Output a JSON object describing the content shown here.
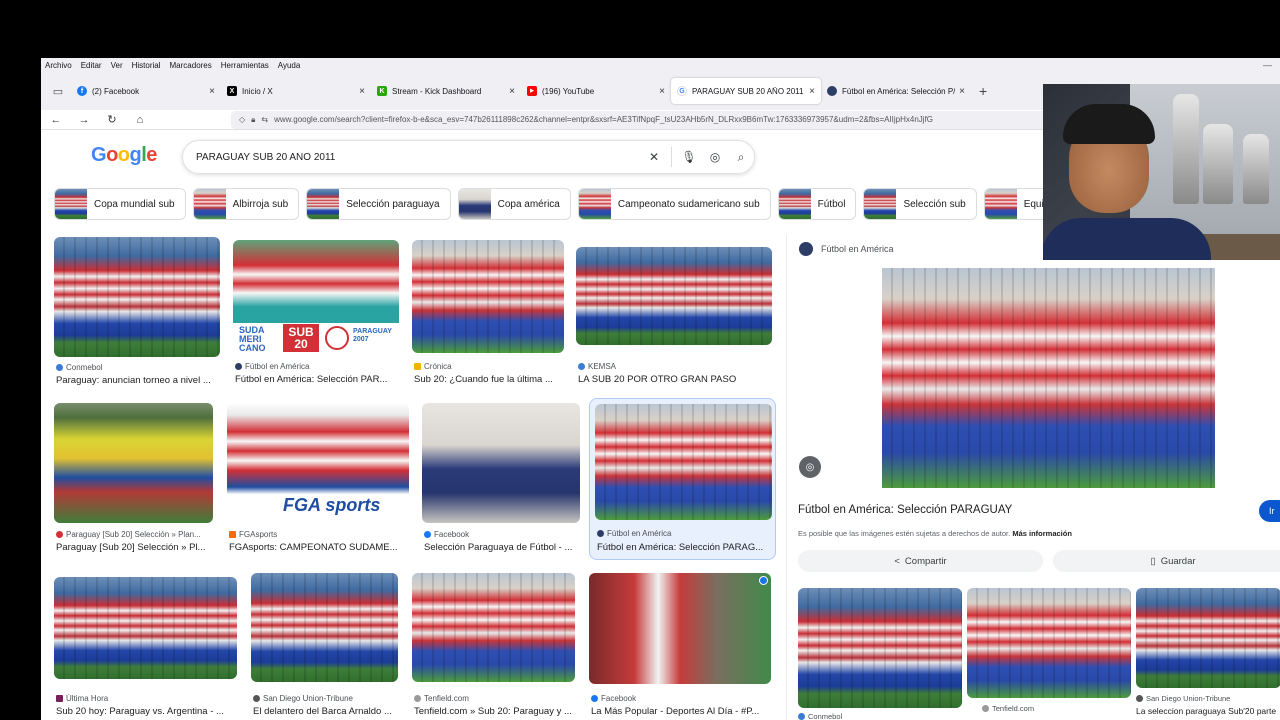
{
  "menu": [
    "Archivo",
    "Editar",
    "Ver",
    "Historial",
    "Marcadores",
    "Herramientas",
    "Ayuda"
  ],
  "tabs": [
    {
      "label": "(2) Facebook",
      "color": "#1877f2",
      "glyph": "f"
    },
    {
      "label": "Inicio / X",
      "color": "#000000",
      "glyph": "X"
    },
    {
      "label": "Stream - Kick Dashboard",
      "color": "#53fc18",
      "glyph": "K"
    },
    {
      "label": "(196) YouTube",
      "color": "#ff0000",
      "glyph": "▶"
    },
    {
      "label": "PARAGUAY SUB 20 AÑO 2011 -",
      "color": "#4285f4",
      "glyph": "G"
    },
    {
      "label": "Fútbol en América: Selección P/",
      "color": "#2c3e66",
      "glyph": "●"
    }
  ],
  "url": "www.google.com/search?client=firefox-b-e&sca_esv=747b26111898c262&channel=entpr&sxsrf=AE3TifNpqF_tsU23AHb5rN_DLRxx9B6mTw:1763336973957&udm=2&fbs=AIIjpHx4nJjfG",
  "google_logo": [
    "G",
    "o",
    "o",
    "g",
    "l",
    "e"
  ],
  "search_query": "PARAGUAY SUB 20 AÑO 2011",
  "chips": [
    "Copa mundial sub",
    "Albirroja sub",
    "Selección paraguaya",
    "Copa américa",
    "Campeonato sudamericano sub",
    "Fútbol",
    "Selección sub",
    "Equipo"
  ],
  "results": [
    {
      "source": "Conmebol",
      "title": "Paraguay: anuncian torneo a nivel ..."
    },
    {
      "source": "Fútbol en América",
      "title": "Fútbol en América: Selección PAR..."
    },
    {
      "source": "Crónica",
      "title": "Sub 20: ¿Cuando fue la última ..."
    },
    {
      "source": "KEMSA",
      "title": "LA SUB 20 POR OTRO GRAN PASO"
    },
    {
      "source": "Paraguay [Sub 20] Selección » Plan...",
      "title": "Paraguay [Sub 20] Selección » Pl..."
    },
    {
      "source": "FGAsports",
      "title": "FGAsports: CAMPEONATO SUDAME..."
    },
    {
      "source": "Facebook",
      "title": "Selección Paraguaya de Fútbol - ..."
    },
    {
      "source": "Fútbol en América",
      "title": "Fútbol en América: Selección PARAG..."
    },
    {
      "source": "Última Hora",
      "title": "Sub 20 hoy: Paraguay vs. Argentina - ..."
    },
    {
      "source": "San Diego Union-Tribune",
      "title": "El delantero del Barca Arnaldo ..."
    },
    {
      "source": "Tenfield.com",
      "title": "Tenfield.com » Sub 20: Paraguay y ..."
    },
    {
      "source": "Facebook",
      "title": "La Más Popular - Deportes Al Día - #P..."
    }
  ],
  "image_overlay_texts": {
    "suda": "SUDA MERI CANO",
    "sub20": "SUB 20",
    "paraguay2007": "PARAGUAY 2007",
    "fga": "FGA sports"
  },
  "panel": {
    "source": "Fútbol en América",
    "title": "Fútbol en América: Selección PARAGUAY",
    "note": "Es posible que las imágenes estén sujetas a derechos de autor.",
    "more_info": "Más información",
    "visit_label": "Ir",
    "share_label": "Compartir",
    "save_label": "Guardar",
    "related": [
      {
        "source": "Conmebol",
        "title": ""
      },
      {
        "source": "Tenfield.com",
        "title": ""
      },
      {
        "source": "San Diego Union-Tribune",
        "title": "La seleccion paraguaya Sub'20 parte"
      }
    ]
  }
}
